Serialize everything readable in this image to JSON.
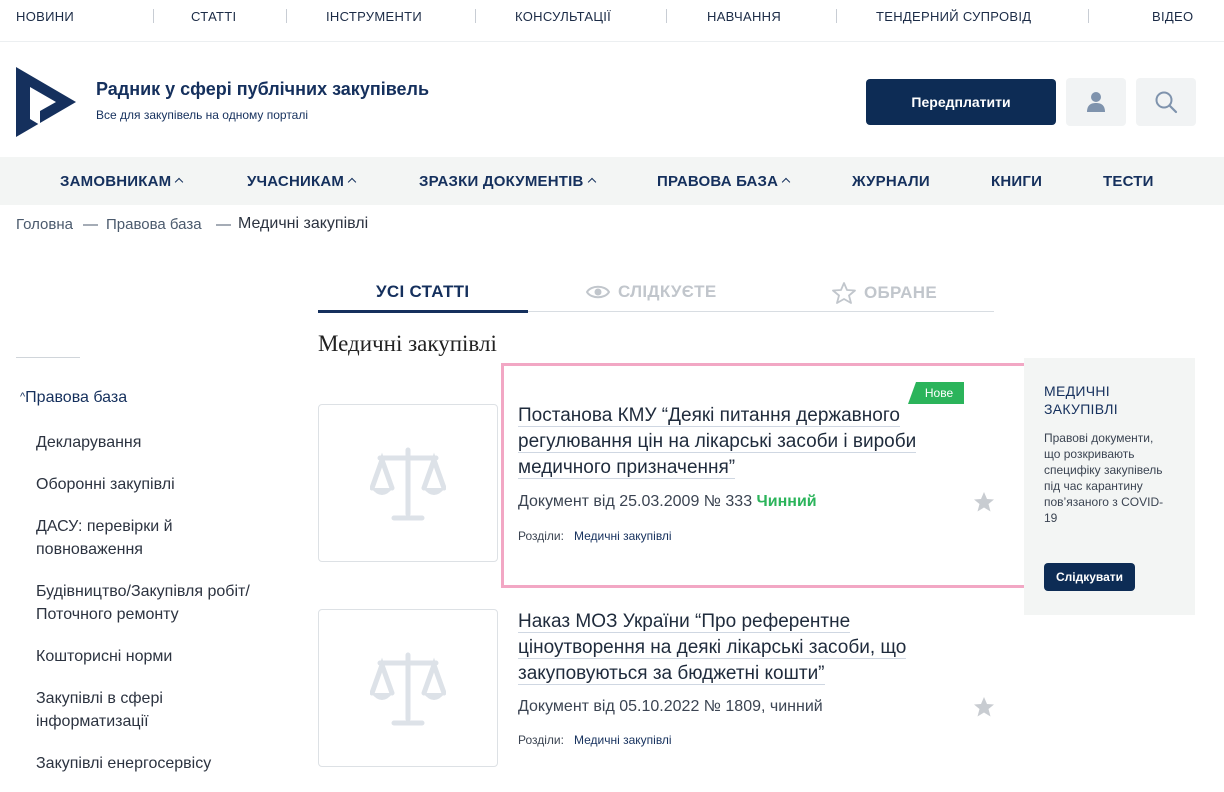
{
  "top_nav": [
    "НОВИНИ",
    "СТАТТІ",
    "ІНСТРУМЕНТИ",
    "КОНСУЛЬТАЦІЇ",
    "НАВЧАННЯ",
    "ТЕНДЕРНИЙ СУПРОВІД",
    "ВІДЕО"
  ],
  "header": {
    "title": "Радник у сфері публічних закупівель",
    "subtitle": "Все для закупівель на одному порталі",
    "subscribe_label": "Передплатити",
    "user_icon": "user-icon",
    "search_icon": "search-icon"
  },
  "main_menu": [
    "ЗАМОВНИКАМ",
    "УЧАСНИКАМ",
    "ЗРАЗКИ ДОКУМЕНТІВ",
    "ПРАВОВА БАЗА",
    "ЖУРНАЛИ",
    "КНИГИ",
    "ТЕСТИ"
  ],
  "breadcrumb": {
    "home": "Головна",
    "separator": "—",
    "parent": "Правова база",
    "current": "Медичні закупівлі"
  },
  "tabs": {
    "all": "УСІ СТАТТІ",
    "following": "СЛІДКУЄТЕ",
    "favorites": "ОБРАНЕ"
  },
  "section_title": "Медичні закупівлі",
  "sidebar": {
    "heading": "Правова база",
    "items": [
      "Декларування",
      "Оборонні закупівлі",
      "ДАСУ: перевірки й повноваження",
      "Будівництво/Закупівля робіт/ Поточного ремонту",
      "Кошторисні норми",
      "Закупівлі в сфері інформатизації",
      "Закупівлі енергосервісу"
    ]
  },
  "articles": [
    {
      "badge": "Нове",
      "title": "Постанова КМУ “Деякі питання державного регулювання цін на лікарські засоби і вироби медичного призначення”",
      "doc": "Документ від 25.03.2009 № 333",
      "status": "Чинний",
      "sections_label": "Розділи:",
      "section_link": "Медичні закупівлі"
    },
    {
      "title": "Наказ МОЗ України “Про референтне ціноутворення на деякі лікарські засоби, що закуповуються за бюджетні кошти”",
      "doc": "Документ від 05.10.2022 № 1809, чинний",
      "sections_label": "Розділи:",
      "section_link": "Медичні закупівлі"
    }
  ],
  "promo": {
    "title": "МЕДИЧНІ ЗАКУПІВЛІ",
    "text": "Правові документи, що розкривають специфіку закупівель під час карантину пов’язаного з COVID-19",
    "button": "Слідкувати"
  },
  "colors": {
    "brand_dark": "#0d2c55",
    "status_green": "#2bb45b",
    "highlight_pink": "#f2a7c4"
  }
}
